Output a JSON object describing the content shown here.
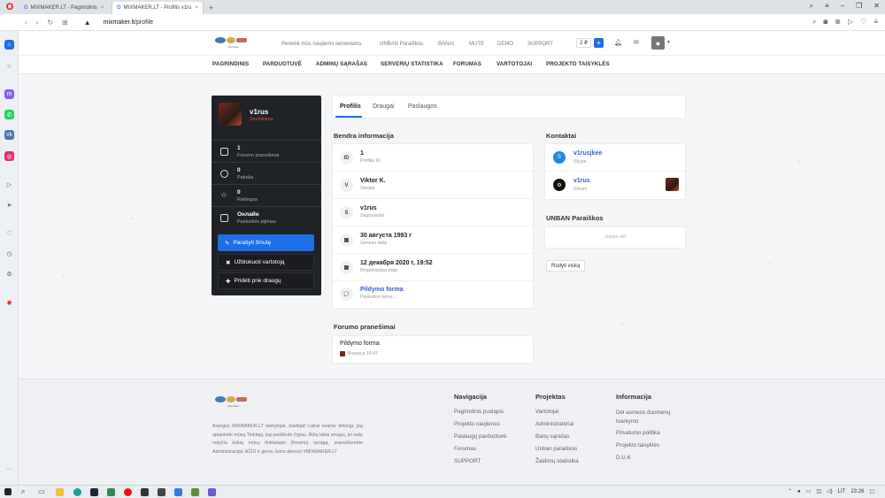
{
  "browser": {
    "tabs": [
      {
        "title": "MIXMAKER.LT - Pagrindinis",
        "close": "×"
      },
      {
        "title": "MIXMAKER.LT - Profilis v1ru",
        "close": "×"
      }
    ],
    "new_tab": "+",
    "url_host": "mixmaker.lt",
    "url_path": "/profile"
  },
  "header": {
    "logo_text": "mixmaker",
    "top_links": [
      "Peremk mūs naujiems serveriams",
      "UNBAN Paraiškos",
      "BANAI",
      "MUTE",
      "DEMO",
      "SUPPORT"
    ],
    "balance": "2 ₽",
    "add_label": "+"
  },
  "main_nav": [
    "PAGRINDINIS",
    "PARDUOTUVĖ",
    "ADMINŲ SĄRAŠAS",
    "SERVERIŲ STATISTIKA",
    "FORUMAS",
    "VARTOTOJAI",
    "PROJEKTO TAISYKLĖS"
  ],
  "profile": {
    "name": "v1rus",
    "role": "Savininkas",
    "stats": [
      {
        "value": "1",
        "label": "Forumo pranešimai",
        "icon": "message-icon"
      },
      {
        "value": "0",
        "label": "Patinka",
        "icon": "heart-icon"
      },
      {
        "value": "0",
        "label": "Reitingas",
        "icon": "star-icon"
      },
      {
        "value": "Онлайн",
        "label": "Paskutinis įėjimas",
        "icon": "calendar-icon"
      }
    ],
    "buttons": {
      "write": "Parašyti žinutę",
      "block": "Užblokuoti vartotoją",
      "add_friend": "Pridėti prie draugų"
    }
  },
  "content_tabs": [
    "Profilis",
    "Draugai",
    "Paslaugos"
  ],
  "general": {
    "title": "Bendra informacija",
    "rows": [
      {
        "icon": "ID",
        "value": "1",
        "label": "Profilio ID"
      },
      {
        "icon": "V",
        "value": "Viktor K.",
        "label": "Vardas"
      },
      {
        "icon": "S",
        "value": "v1rus",
        "label": "Slapyvardis"
      },
      {
        "icon": "▦",
        "value": "30 августа 1993 г",
        "label": "Gimimo data"
      },
      {
        "icon": "▦",
        "value": "12 декабря 2020 г, 19:52",
        "label": "Registracijos data"
      },
      {
        "icon": "💬",
        "value": "Pildymo forma",
        "label": "Paskutinė tema..."
      }
    ]
  },
  "forum": {
    "title": "Forumo pranešimai",
    "item_title": "Pildymo forma",
    "item_time": "Вчера в 10:47"
  },
  "contacts": {
    "title": "Kontaktai",
    "items": [
      {
        "value": "v1rusjkee",
        "label": "Skype",
        "color": "#1a8ae5"
      },
      {
        "value": "v1rus",
        "label": "Steam",
        "color": "#111111"
      }
    ]
  },
  "unban": {
    "title": "UNBAN Paraiškos",
    "empty": "Jokios vėl",
    "show_all": "Rodyti viską"
  },
  "footer": {
    "logo_text": "mixmaker",
    "description": "Brangūs MIXMAKER.LT lankytojai, žaidėjai! Labai esame dėkingi, jog aplankėte mūsų Tinklapį, jog pasilikote čigiau. Būtų labai smagu, jei radę netyčia kokią mūsų tinklalapio (forumo) spragą, praneštumėte Administracijai. AČIŪ ir geros Jums dienos! #MIXMAKER.LT",
    "columns": [
      {
        "title": "Navigacija",
        "items": [
          "Pagrindinis puslapis",
          "Projekto naujienos",
          "Paslaugų parduotuvė",
          "Forumas",
          "SUPPORT"
        ]
      },
      {
        "title": "Projektas",
        "items": [
          "Vartotojai",
          "Administratoriai",
          "Banų sąrašas",
          "Unban paraiškos",
          "Žaidimų statistika"
        ]
      },
      {
        "title": "Informacija",
        "items": [
          "Dėl asmens duomenų tvarkymo",
          "Privatumo politika",
          "Projekto taisyklės",
          "D.U.K"
        ]
      }
    ]
  },
  "taskbar": {
    "lang": "LIT",
    "time": "23:26"
  },
  "colors": {
    "accent": "#1e6ee6",
    "card_dark": "#1f2227",
    "role_red": "#e14d3f",
    "link_blue": "#2d5fc8"
  }
}
